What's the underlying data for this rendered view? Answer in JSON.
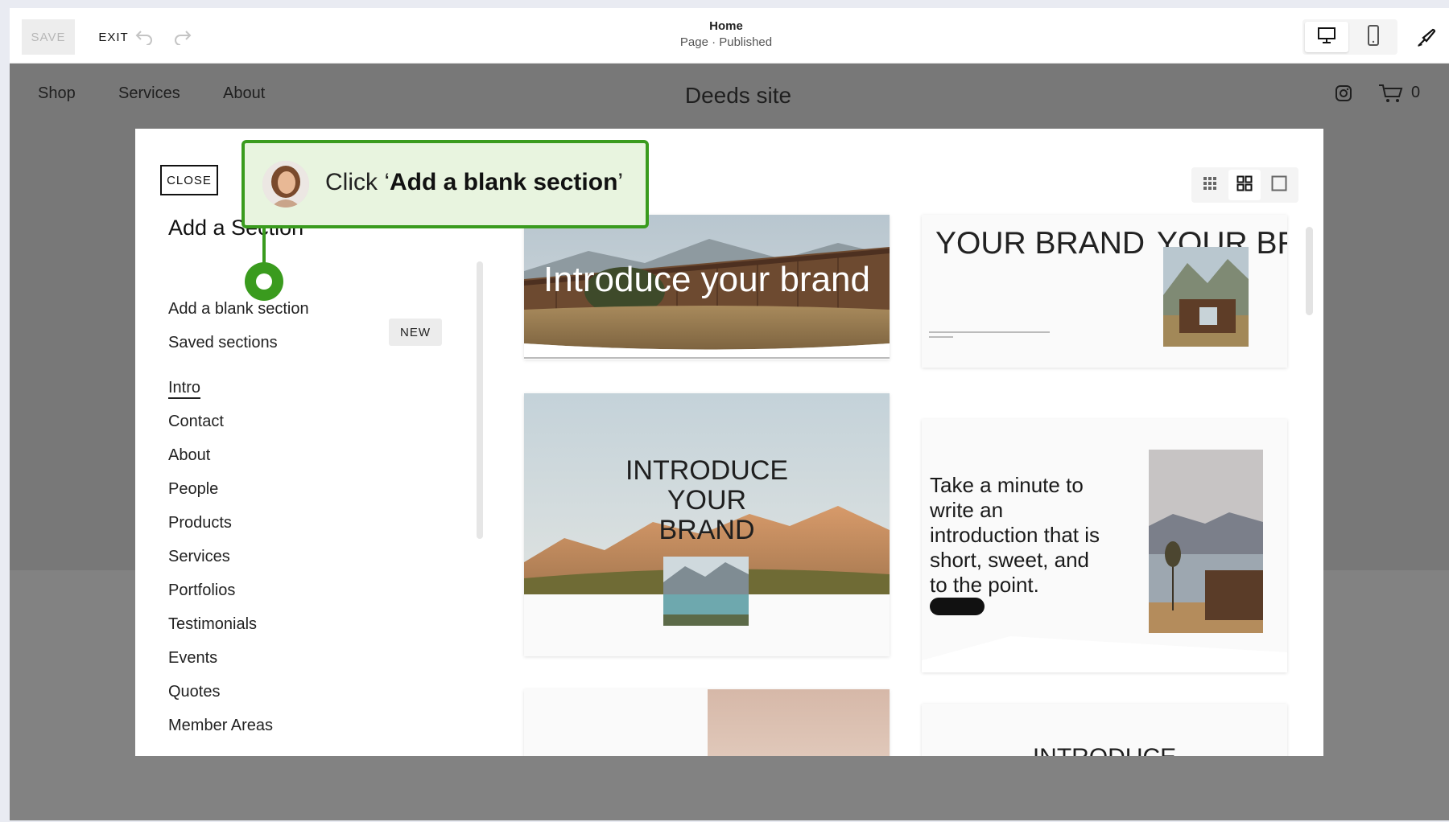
{
  "toolbar": {
    "save_label": "SAVE",
    "exit_label": "EXIT",
    "page_title": "Home",
    "page_status": "Page · Published"
  },
  "site": {
    "nav": [
      "Shop",
      "Services",
      "About"
    ],
    "title": "Deeds site",
    "cart_count": "0"
  },
  "modal": {
    "close_label": "CLOSE",
    "heading": "Add a Section",
    "add_blank_label": "Add a blank section",
    "saved_sections_label": "Saved sections",
    "new_badge": "NEW",
    "categories": [
      "Intro",
      "Contact",
      "About",
      "People",
      "Products",
      "Services",
      "Portfolios",
      "Testimonials",
      "Events",
      "Quotes",
      "Member Areas"
    ],
    "active_category": "Intro",
    "templates": {
      "t1_title": "Introduce your brand",
      "t2_title": "YOUR BRAND",
      "t2_title_repeat": "YOUR BR",
      "t3_title_line1": "INTRODUCE",
      "t3_title_line2": "YOUR",
      "t3_title_line3": "BRAND",
      "t4_text": "Take a minute to write an introduction that is short, sweet, and to the point.",
      "t6_title": "INTRODUCE"
    }
  },
  "tooltip": {
    "prefix": "Click ‘",
    "bold": "Add a blank section",
    "suffix": "’"
  },
  "colors": {
    "accent_green": "#3a9b1e",
    "tooltip_bg": "#e8f4df",
    "site_overlay": "#787878"
  }
}
